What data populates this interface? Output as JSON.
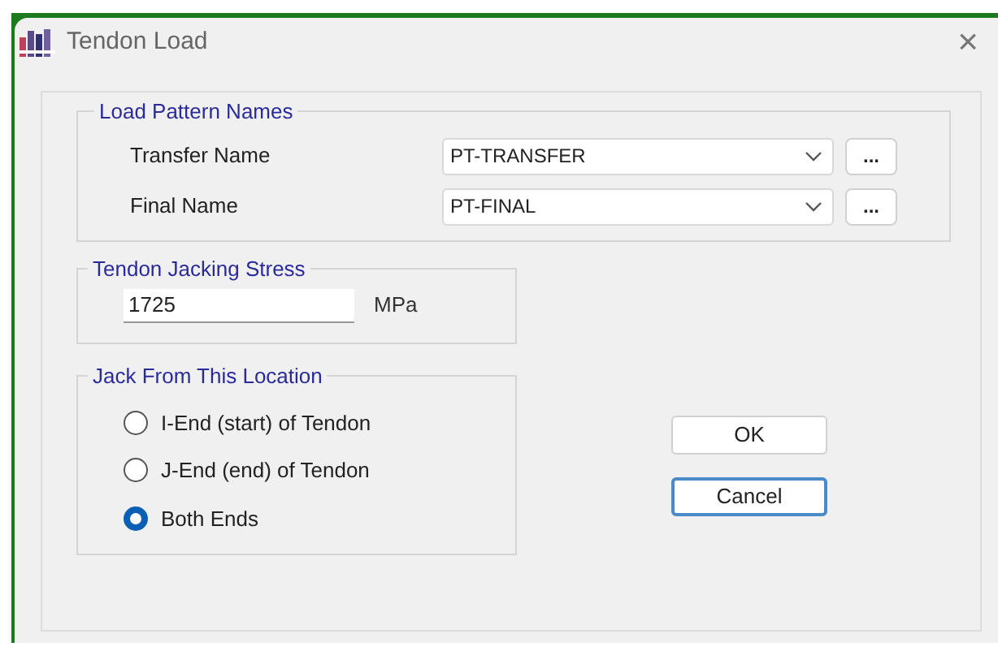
{
  "window": {
    "title": "Tendon Load",
    "close": "×"
  },
  "load_pattern_names": {
    "title": "Load Pattern Names",
    "rows": [
      {
        "label": "Transfer Name",
        "value": "PT-TRANSFER",
        "button": "..."
      },
      {
        "label": "Final Name",
        "value": "PT-FINAL",
        "button": "..."
      }
    ]
  },
  "jacking_stress": {
    "title": "Tendon Jacking Stress",
    "value": "1725",
    "unit": "MPa"
  },
  "jack_location": {
    "title": "Jack From This Location",
    "options": [
      {
        "label": "I-End (start) of Tendon",
        "selected": false
      },
      {
        "label": "J-End (end) of Tendon",
        "selected": false
      },
      {
        "label": "Both Ends",
        "selected": true
      }
    ]
  },
  "buttons": [
    {
      "label": "OK",
      "focused": false
    },
    {
      "label": "Cancel",
      "focused": true
    }
  ]
}
